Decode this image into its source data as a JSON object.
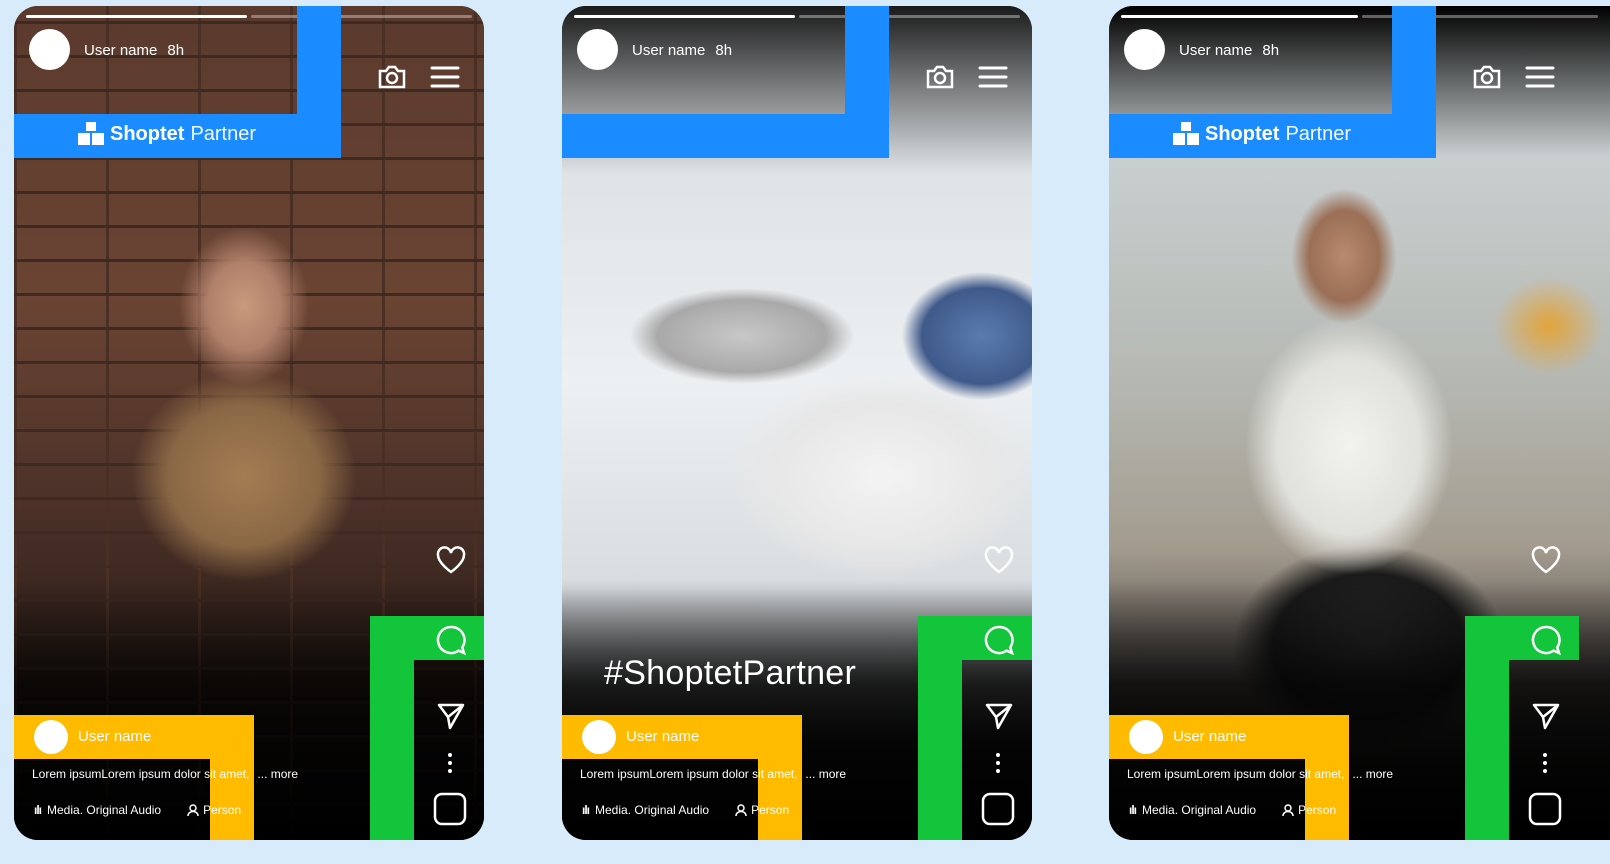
{
  "brand": {
    "name_bold": "Shoptet",
    "name_light": "Partner"
  },
  "colors": {
    "blue": "#1a8cff",
    "green": "#13c53a",
    "yellow": "#ffbb00",
    "page_bg": "#d8ebfb"
  },
  "icons": {
    "camera": "camera-icon",
    "menu": "hamburger-menu-icon",
    "heart": "heart-icon",
    "comment": "comment-icon",
    "share": "send-icon",
    "more": "more-vertical-icon",
    "square": "square-icon",
    "audio": "audio-icon",
    "person": "person-icon"
  },
  "stories": [
    {
      "top_user": "User name",
      "time": "8h",
      "bottom_user": "User name",
      "caption": "Lorem ipsumLorem ipsum dolor sit amet,",
      "more": "... more",
      "audio": "Media. Original Audio",
      "person": "Person",
      "hashtag": "",
      "progress": [
        1.0,
        0.0
      ]
    },
    {
      "top_user": "User name",
      "time": "8h",
      "bottom_user": "User name",
      "caption": "Lorem ipsumLorem ipsum dolor sit amet,",
      "more": "... more",
      "audio": "Media. Original Audio",
      "person": "Person",
      "hashtag": "#ShoptetPartner",
      "progress": [
        1.0,
        0.0
      ]
    },
    {
      "top_user": "User name",
      "time": "8h",
      "bottom_user": "User name",
      "caption": "Lorem ipsumLorem ipsum dolor sit amet,",
      "more": "... more",
      "audio": "Media. Original Audio",
      "person": "Person",
      "hashtag": "",
      "progress": [
        1.0,
        0.0
      ]
    }
  ]
}
